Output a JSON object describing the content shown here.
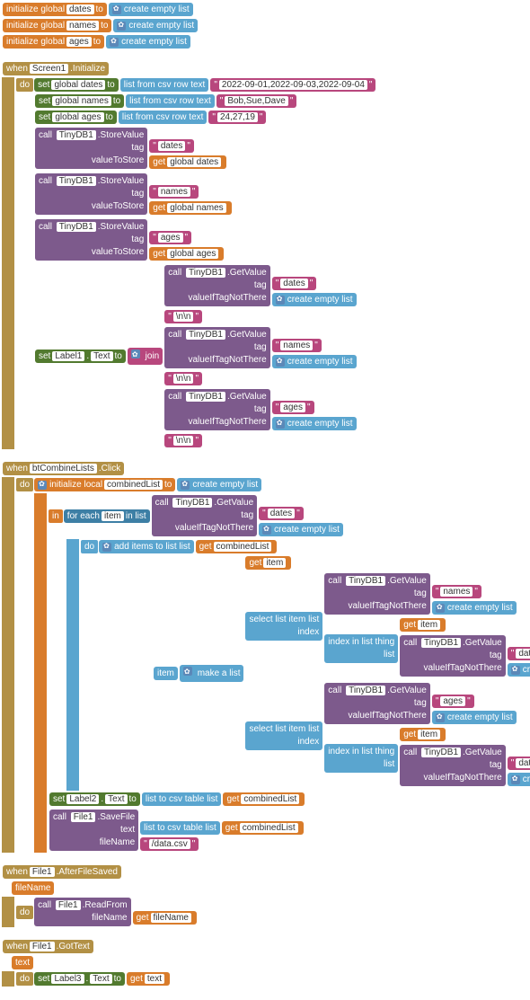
{
  "globals": {
    "init": "initialize global",
    "to": "to",
    "dates": "dates",
    "names": "names",
    "ages": "ages",
    "createEmpty": "create empty list"
  },
  "screen1": {
    "when": "when",
    "screen": "Screen1",
    "initialize": ".Initialize",
    "do": "do",
    "set": "set",
    "globalDates": "global dates",
    "globalNames": "global names",
    "globalAges": "global ages",
    "to": "to",
    "listFromCsv": "list from csv row text",
    "datesVal": "2022-09-01,2022-09-03,2022-09-04",
    "namesVal": "Bob,Sue,Dave",
    "agesVal": "24,27,19",
    "call": "call",
    "tinyDB": "TinyDB1",
    "storeValue": ".StoreValue",
    "tag": "tag",
    "valueToStore": "valueToStore",
    "tagDates": "dates",
    "tagNames": "names",
    "tagAges": "ages",
    "get": "get",
    "label1": "Label1",
    "text": "Text",
    "join": "join",
    "getValue": ".GetValue",
    "valueIfTag": "valueIfTagNotThere",
    "newline": "\\n\\n"
  },
  "combine": {
    "when": "when",
    "btn": "btCombineLists",
    "click": ".Click",
    "do": "do",
    "initLocal": "initialize local",
    "combinedList": "combinedList",
    "to": "to",
    "createEmpty": "create empty list",
    "in": "in",
    "forEach": "for each",
    "item": "item",
    "inList": "in list",
    "call": "call",
    "tinyDB": "TinyDB1",
    "getValue": ".GetValue",
    "tag": "tag",
    "dates": "dates",
    "names": "names",
    "ages": "ages",
    "valueIfTag": "valueIfTagNotThere",
    "addItems": "add items to list",
    "list": "list",
    "get": "get",
    "itemLbl": "item",
    "makeList": "make a list",
    "selectList": "select list item",
    "index": "index",
    "indexInList": "index in list",
    "thing": "thing",
    "set": "set",
    "label2": "Label2",
    "text": "Text",
    "listToCsvTable": "list to csv table",
    "file1": "File1",
    "saveFile": ".SaveFile",
    "textLbl": "text",
    "fileName": "fileName",
    "dataCsv": "/data.csv"
  },
  "afterSaved": {
    "when": "when",
    "file1": "File1",
    "afterFileSaved": ".AfterFileSaved",
    "fileName": "fileName",
    "do": "do",
    "call": "call",
    "readFrom": ".ReadFrom",
    "get": "get"
  },
  "gotText": {
    "when": "when",
    "file1": "File1",
    "gotText": ".GotText",
    "text": "text",
    "do": "do",
    "set": "set",
    "label3": "Label3",
    "txtProp": "Text",
    "to": "to",
    "get": "get"
  }
}
